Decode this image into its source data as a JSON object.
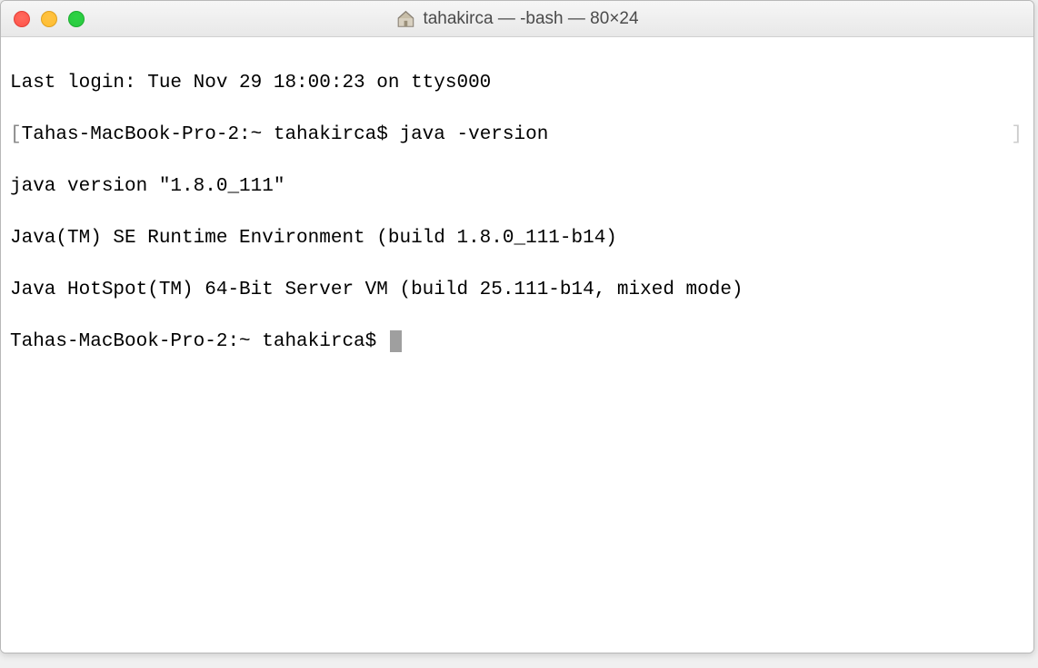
{
  "window": {
    "title": "tahakirca — -bash — 80×24"
  },
  "terminal": {
    "lines": {
      "last_login": "Last login: Tue Nov 29 18:00:23 on ttys000",
      "prompt1_full": "Tahas-MacBook-Pro-2:~ tahakirca$ java -version",
      "java_version": "java version \"1.8.0_111\"",
      "java_runtime": "Java(TM) SE Runtime Environment (build 1.8.0_111-b14)",
      "java_hotspot": "Java HotSpot(TM) 64-Bit Server VM (build 25.111-b14, mixed mode)",
      "prompt2": "Tahas-MacBook-Pro-2:~ tahakirca$ "
    },
    "bracket_left": "[",
    "bracket_right": "]"
  }
}
